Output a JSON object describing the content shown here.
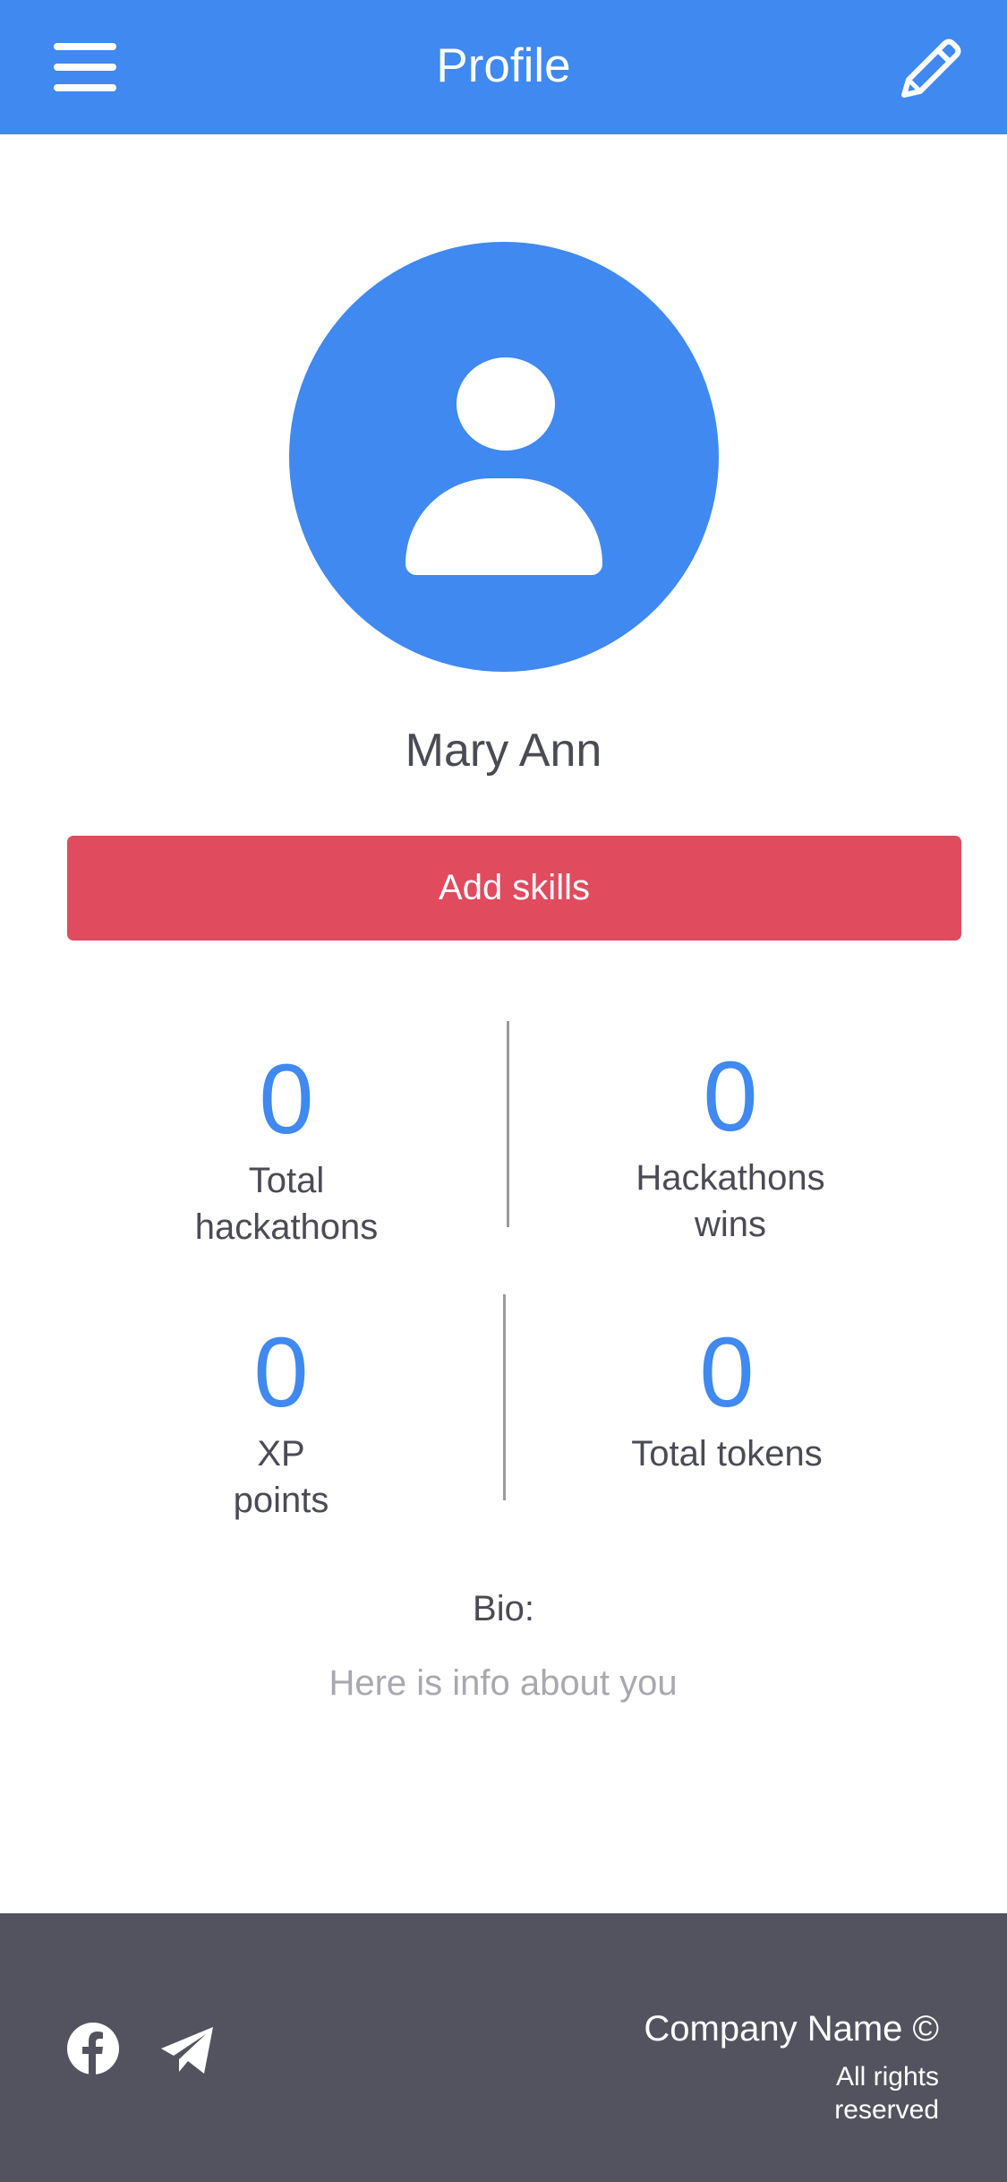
{
  "header": {
    "title": "Profile",
    "menu_icon": "hamburger-menu-icon",
    "edit_icon": "pencil-icon"
  },
  "profile": {
    "avatar_icon": "user-avatar-icon",
    "name": "Mary Ann",
    "add_skills_label": "Add skills"
  },
  "stats": {
    "total_hackathons": {
      "value": "0",
      "label": "Total hackathons"
    },
    "hackathon_wins": {
      "value": "0",
      "label": "Hackathons wins"
    },
    "xp_points": {
      "value": "0",
      "label": "XP points"
    },
    "total_tokens": {
      "value": "0",
      "label": "Total tokens"
    }
  },
  "bio": {
    "label": "Bio:",
    "text": "Here is info about you"
  },
  "footer": {
    "social": [
      "facebook-icon",
      "telegram-icon"
    ],
    "company": "Company Name ©",
    "rights": "All rights reserved"
  },
  "colors": {
    "primary": "#3f89f1",
    "accent": "#e04b5e",
    "footer_bg": "#53535f",
    "text": "#4b4b56",
    "muted": "#a8a8b0"
  }
}
